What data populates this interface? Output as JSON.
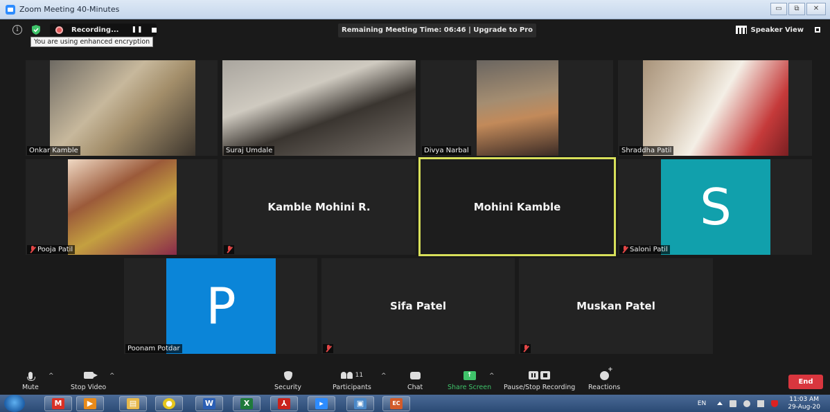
{
  "window": {
    "title": "Zoom Meeting 40-Minutes",
    "buttons": [
      "▭",
      "⧉",
      "✕"
    ]
  },
  "topbar": {
    "recording_label": "Recording...",
    "pause_glyph": "❚❚",
    "tooltip": "You are using enhanced encryption",
    "remaining_time": "Remaining Meeting Time: 06:46 | Upgrade to Pro",
    "speaker_view": "Speaker View",
    "info_glyph": "i"
  },
  "participants": [
    {
      "name": "Onkar Kamble",
      "type": "video",
      "muted": false
    },
    {
      "name": "Suraj Umdale",
      "type": "video",
      "muted": false
    },
    {
      "name": "Divya Narbal",
      "type": "video",
      "muted": false
    },
    {
      "name": "Shraddha Patil",
      "type": "video",
      "muted": false
    },
    {
      "name": "Pooja Patil",
      "type": "video",
      "muted": true
    },
    {
      "name": "Kamble Mohini R.",
      "type": "name",
      "muted": true
    },
    {
      "name": "Mohini Kamble",
      "type": "name",
      "muted": false,
      "active_speaker": true
    },
    {
      "name": "Saloni Patil",
      "type": "avatar",
      "initial": "S",
      "avatar_color": "#11a0ac",
      "muted": true
    },
    {
      "name": "Poonam Potdar",
      "type": "avatar",
      "initial": "P",
      "avatar_color": "#0b85d8",
      "muted": false
    },
    {
      "name": "Sifa Patel",
      "type": "name",
      "muted": true
    },
    {
      "name": "Muskan Patel",
      "type": "name",
      "muted": true
    }
  ],
  "toolbar": {
    "mute": "Mute",
    "stop_video": "Stop Video",
    "security": "Security",
    "participants": "Participants",
    "participants_count": "11",
    "chat": "Chat",
    "share_screen": "Share Screen",
    "pause_stop_recording": "Pause/Stop Recording",
    "reactions": "Reactions",
    "end": "End",
    "caret": "^",
    "share_arrow": "↑"
  },
  "taskbar": {
    "apps": [
      {
        "icon": "gmail-icon",
        "glyph": "M",
        "color": "#d93025"
      },
      {
        "icon": "media-player-icon",
        "glyph": "▶",
        "color": "#e88a1a"
      },
      {
        "icon": "file-explorer-icon",
        "glyph": "▤",
        "color": "#e6b84a"
      },
      {
        "icon": "chrome-icon",
        "glyph": "●",
        "color": "#e5c51d"
      },
      {
        "icon": "word-icon",
        "glyph": "W",
        "color": "#2b5fb5"
      },
      {
        "icon": "excel-icon",
        "glyph": "X",
        "color": "#1f7a3c"
      },
      {
        "icon": "acrobat-icon",
        "glyph": "⅄",
        "color": "#c9221c"
      },
      {
        "icon": "zoom-icon",
        "glyph": "▸",
        "color": "#2d8cff"
      },
      {
        "icon": "photo-viewer-icon",
        "glyph": "▣",
        "color": "#4a88c8"
      },
      {
        "icon": "presentation-icon",
        "glyph": "EC",
        "color": "#d25b2a"
      }
    ],
    "language": "EN",
    "time": "11:03 AM",
    "date": "29-Aug-20"
  },
  "colors": {
    "active_speaker_border": "#d8e05a",
    "end_button": "#d9363e",
    "share_screen": "#3fc36a"
  }
}
